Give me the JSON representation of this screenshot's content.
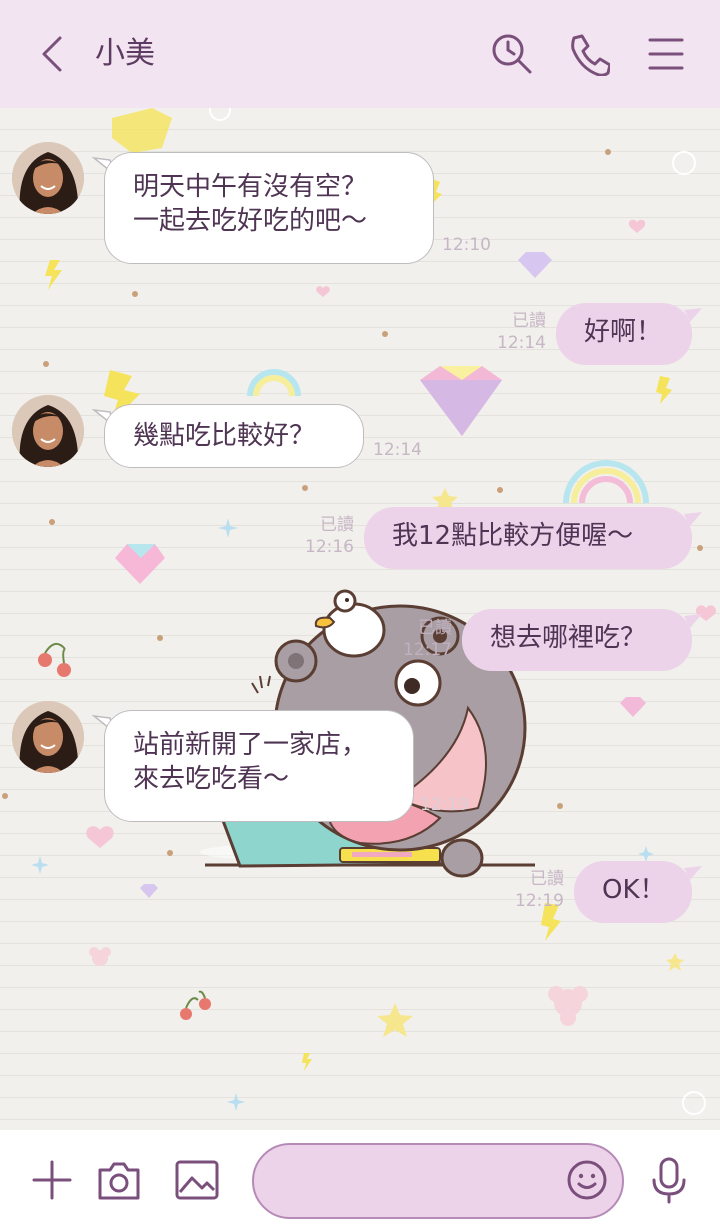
{
  "header": {
    "title": "小美",
    "icons": [
      "back-icon",
      "search-icon",
      "phone-icon",
      "menu-icon"
    ]
  },
  "messages": [
    {
      "side": "in",
      "text": "明天中午有沒有空？\n一起去吃好吃的吧～",
      "time": "12:10"
    },
    {
      "side": "out",
      "text": "好啊！",
      "read": "已讀",
      "time": "12:14"
    },
    {
      "side": "in",
      "text": "幾點吃比較好？",
      "time": "12:14"
    },
    {
      "side": "out",
      "text": "我12點比較方便喔～",
      "read": "已讀",
      "time": "12:16"
    },
    {
      "side": "out",
      "text": "想去哪裡吃？",
      "read": "已讀",
      "time": "12:17"
    },
    {
      "side": "in",
      "text": "站前新開了一家店，\n來去吃吃看～",
      "time": "12:19"
    },
    {
      "side": "out",
      "text": "OK！",
      "read": "已讀",
      "time": "12:19"
    }
  ],
  "footer": {
    "icons": [
      "plus-icon",
      "camera-icon",
      "image-icon",
      "emoji-icon",
      "mic-icon"
    ],
    "input_value": ""
  },
  "colors": {
    "header_bg": "#f2e4f0",
    "accent": "#7a4f7c",
    "out_bubble": "#ecd3ea",
    "in_bubble": "#ffffff",
    "meta_text": "#c7b6c6"
  }
}
